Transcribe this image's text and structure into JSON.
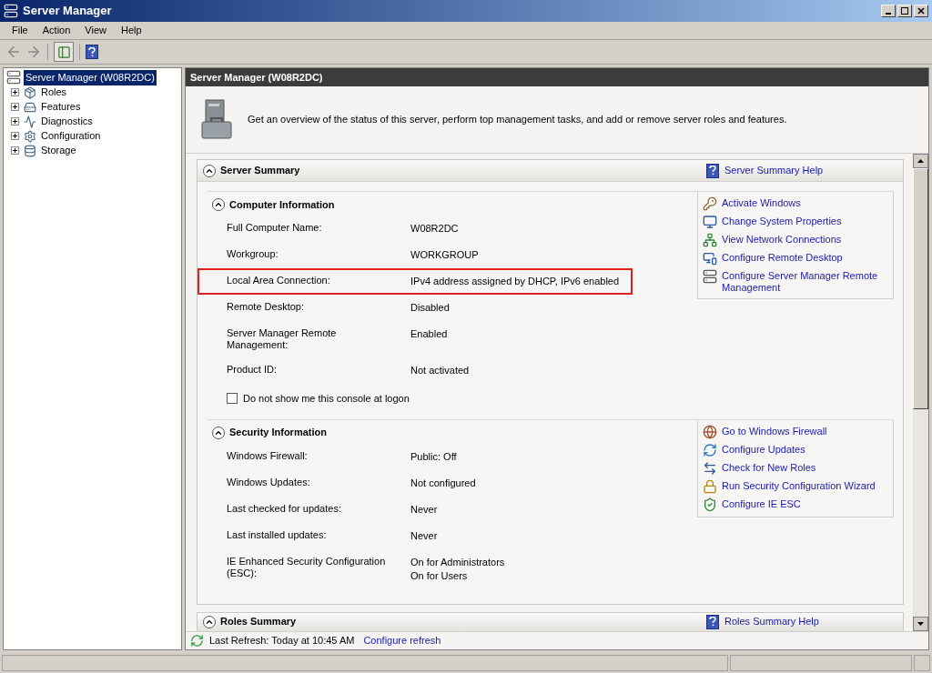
{
  "window": {
    "title": "Server Manager"
  },
  "menu": [
    "File",
    "Action",
    "View",
    "Help"
  ],
  "tree": {
    "label": "Server Manager (W08R2DC)",
    "selected": true,
    "children": [
      {
        "label": "Roles",
        "expanded": false
      },
      {
        "label": "Features",
        "expanded": false
      },
      {
        "label": "Diagnostics",
        "expanded": false
      },
      {
        "label": "Configuration",
        "expanded": false
      },
      {
        "label": "Storage",
        "expanded": false
      }
    ]
  },
  "pane_header": "Server Manager (W08R2DC)",
  "intro": "Get an overview of the status of this server, perform top management tasks, and add or remove server roles and features.",
  "server_summary": {
    "title": "Server Summary",
    "help_link": "Server Summary Help",
    "expanded": true,
    "subsections": [
      {
        "title": "Computer Information",
        "expanded": true,
        "rows": [
          {
            "label": [
              "Full Computer Name:"
            ],
            "value": [
              "W08R2DC"
            ],
            "highlighted": false
          },
          {
            "label": [
              "Workgroup:"
            ],
            "value": [
              "WORKGROUP"
            ],
            "highlighted": false
          },
          {
            "label": [
              "Local Area Connection:"
            ],
            "value": [
              "IPv4 address assigned by DHCP, IPv6 enabled"
            ],
            "highlighted": true
          },
          {
            "label": [
              "Remote Desktop:"
            ],
            "value": [
              "Disabled"
            ],
            "highlighted": false
          },
          {
            "label": [
              "Server Manager Remote",
              "Management:"
            ],
            "value": [
              "Enabled"
            ],
            "highlighted": false
          },
          {
            "label": [
              "Product ID:"
            ],
            "value": [
              "Not activated"
            ],
            "highlighted": false
          }
        ],
        "checkbox": {
          "label": "Do not show me this console at logon",
          "checked": false
        },
        "tasks": [
          [
            "Activate Windows"
          ],
          [
            "Change System Properties"
          ],
          [
            "View Network Connections"
          ],
          [
            "Configure Remote Desktop"
          ],
          [
            "Configure Server Manager Remote",
            "Management"
          ]
        ]
      },
      {
        "title": "Security Information",
        "expanded": true,
        "rows": [
          {
            "label": [
              "Windows Firewall:"
            ],
            "value": [
              "Public: Off"
            ],
            "highlighted": false
          },
          {
            "label": [
              "Windows Updates:"
            ],
            "value": [
              "Not configured"
            ],
            "highlighted": false
          },
          {
            "label": [
              "Last checked for updates:"
            ],
            "value": [
              "Never"
            ],
            "highlighted": false
          },
          {
            "label": [
              "Last installed updates:"
            ],
            "value": [
              "Never"
            ],
            "highlighted": false
          },
          {
            "label": [
              "IE Enhanced Security Configuration",
              "(ESC):"
            ],
            "value": [
              "On for Administrators",
              "On for Users"
            ],
            "highlighted": false
          }
        ],
        "tasks": [
          [
            "Go to Windows Firewall"
          ],
          [
            "Configure Updates"
          ],
          [
            "Check for New Roles"
          ],
          [
            "Run Security Configuration Wizard"
          ],
          [
            "Configure IE ESC"
          ]
        ]
      }
    ]
  },
  "roles_summary": {
    "title": "Roles Summary",
    "help_link": "Roles Summary Help",
    "expanded": true
  },
  "refresh": {
    "text": "Last Refresh: Today at 10:45 AM",
    "link": "Configure refresh"
  }
}
